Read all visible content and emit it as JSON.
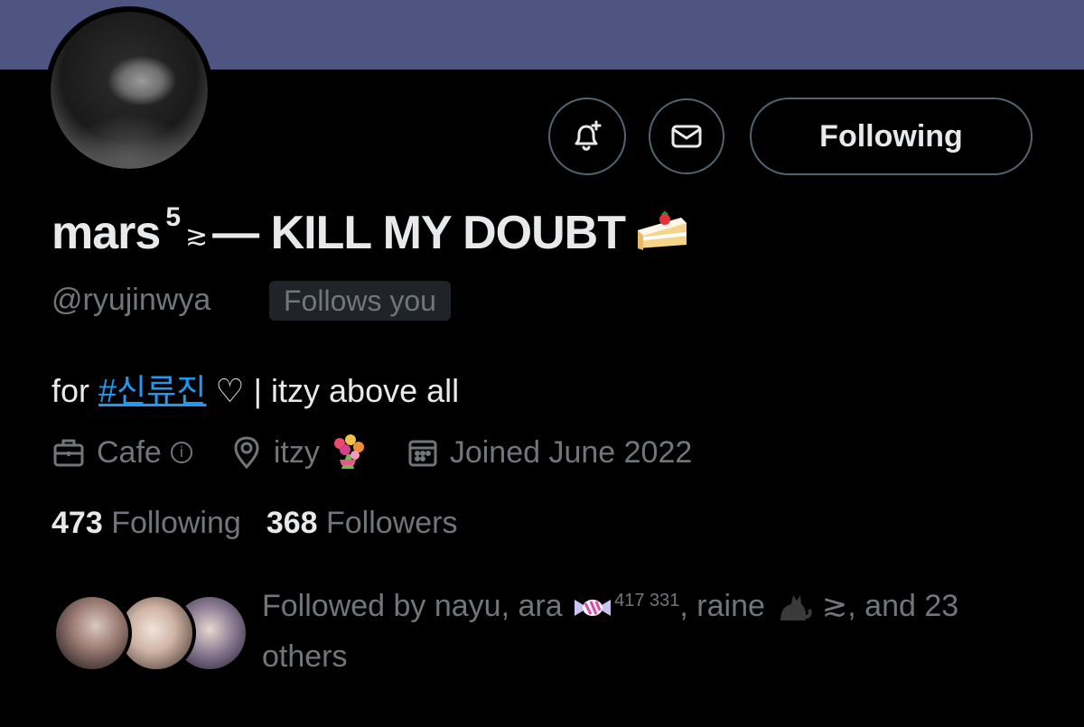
{
  "profile": {
    "name_main": "mars",
    "name_superscript": "5",
    "name_symbol": "≳",
    "name_tail": "— KILL MY DOUBT",
    "name_emoji": "cake-slice-icon",
    "handle": "@ryujinwya",
    "follows_you_badge": "Follows you",
    "bio_prefix": "for ",
    "bio_hashtag": "#신류진",
    "bio_suffix": " ♡ | itzy above all",
    "category": "Cafe",
    "category_info_glyph": "i",
    "location": "itzy",
    "location_emoji": "bouquet-icon",
    "joined": "Joined June 2022",
    "following_count": "473",
    "following_label": "Following",
    "followers_count": "368",
    "followers_label": "Followers"
  },
  "actions": {
    "notify_icon": "bell-plus-icon",
    "message_icon": "mail-icon",
    "follow_button_label": "Following"
  },
  "followed_by": {
    "text_start": "Followed by nayu, ara",
    "candy_emoji": "candy-icon",
    "superscript": "417 331",
    "text_middle": ", raine",
    "cat_emoji": "black-cat-icon",
    "text_end": " ≳, and 23 others"
  },
  "colors": {
    "banner": "#4d5580",
    "background": "#000000",
    "primary_text": "#e7e9ea",
    "secondary_text": "#71767b",
    "link": "#1d9bf0",
    "border": "#536471"
  }
}
